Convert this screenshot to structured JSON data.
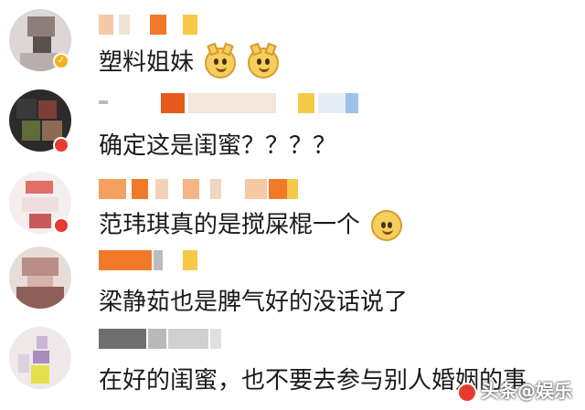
{
  "comments": [
    {
      "text": "塑料姐妹",
      "emoji": [
        "doge-icon",
        "doge-icon"
      ]
    },
    {
      "text": "确定这是闺蜜？？？？"
    },
    {
      "text": "范玮琪真的是搅屎棍一个",
      "emoji": [
        "smile-icon"
      ]
    },
    {
      "text": "梁静茹也是脾气好的没话说了"
    },
    {
      "text": "在好的闺蜜，也不要去参与别人婚姻的事"
    }
  ],
  "watermark": {
    "text": "头条@娱乐"
  },
  "colors": {
    "accent": "#f07a28",
    "pixel_orange": "#f5a060",
    "pixel_yellow": "#f7c948",
    "pixel_gray": "#9a9a9a"
  }
}
